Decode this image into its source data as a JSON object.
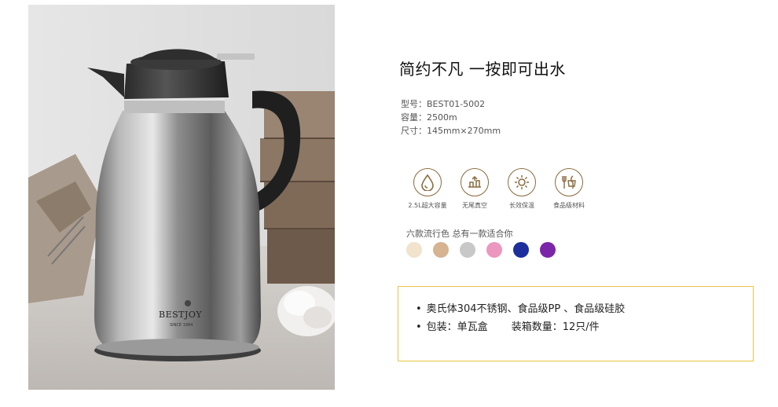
{
  "product": {
    "title": "简约不凡 一按即可出水",
    "brand_logo": "BESTJOY",
    "brand_tagline": "SINCE 1984"
  },
  "specs": [
    {
      "label": "型号：",
      "value": "BEST01-5002"
    },
    {
      "label": "容量：",
      "value": "2500m"
    },
    {
      "label": "尺寸：",
      "value": "145mm×270mm"
    }
  ],
  "features": [
    {
      "icon": "water-drop-icon",
      "label": "2.5L超大容量"
    },
    {
      "icon": "bottle-tail-icon",
      "label": "无尾真空"
    },
    {
      "icon": "keep-warm-icon",
      "label": "长效保温"
    },
    {
      "icon": "food-grade-icon",
      "label": "食品级材料"
    }
  ],
  "colors": {
    "title": "六款流行色  总有一款适合你",
    "swatches": [
      "#f1e3cc",
      "#d6b391",
      "#c8c8c8",
      "#ec97bf",
      "#1d2f9c",
      "#7b26a8"
    ]
  },
  "info": {
    "line1": "奥氏体304不锈钢、食品级PP 、食品级硅胶",
    "line2_a": "包装：单瓦盒",
    "line2_b": "装箱数量：12只/件"
  },
  "accent_colors": {
    "icon_brown": "#8a6a3c",
    "box_border": "#e8c547"
  }
}
